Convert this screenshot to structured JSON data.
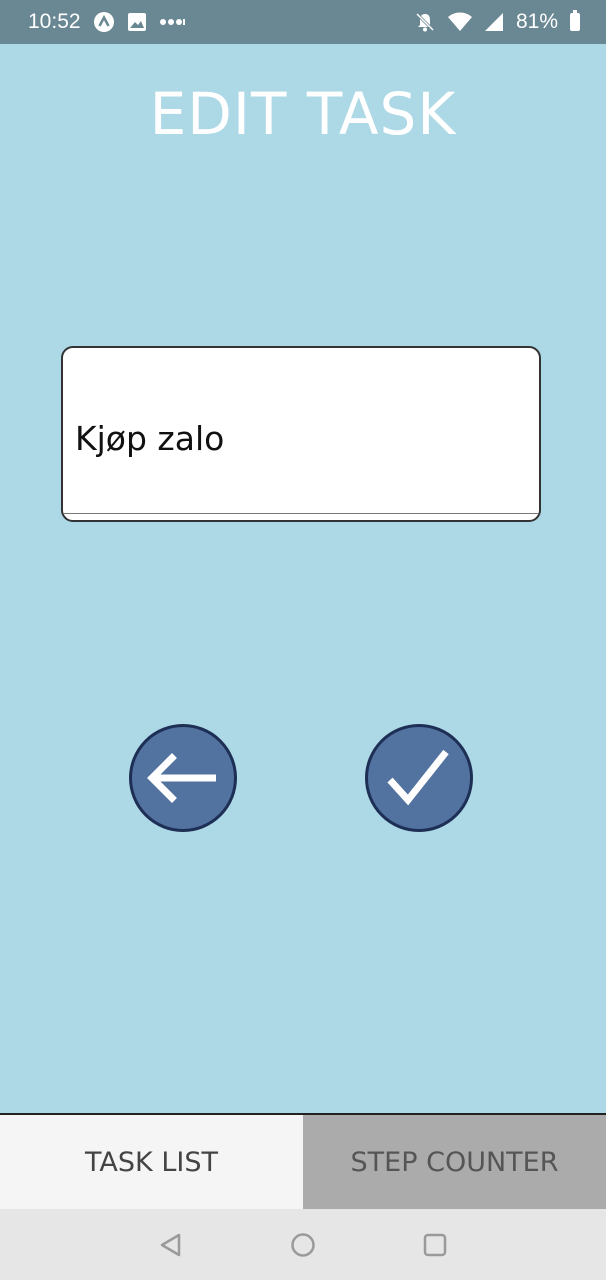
{
  "status_bar": {
    "time": "10:52",
    "battery": "81%",
    "icons_left": [
      "app-a-icon",
      "image-icon",
      "more-dots-icon"
    ],
    "icons_right": [
      "bell-muted-icon",
      "wifi-icon",
      "signal-icon",
      "battery-icon"
    ]
  },
  "page": {
    "title": "EDIT TASK"
  },
  "task_field": {
    "value": "Kjøp zalo"
  },
  "actions": {
    "back_icon": "arrow-left-icon",
    "confirm_icon": "checkmark-icon"
  },
  "tabs": [
    {
      "label": "TASK LIST",
      "selected": true
    },
    {
      "label": "STEP COUNTER",
      "selected": false
    }
  ],
  "colors": {
    "background": "#ADD8E6",
    "status_bar": "#6A8894",
    "button_fill": "#5272A0",
    "button_border": "#1E2F55",
    "tab_selected": "#F5F5F5",
    "tab_unselected": "#ABABAB"
  }
}
